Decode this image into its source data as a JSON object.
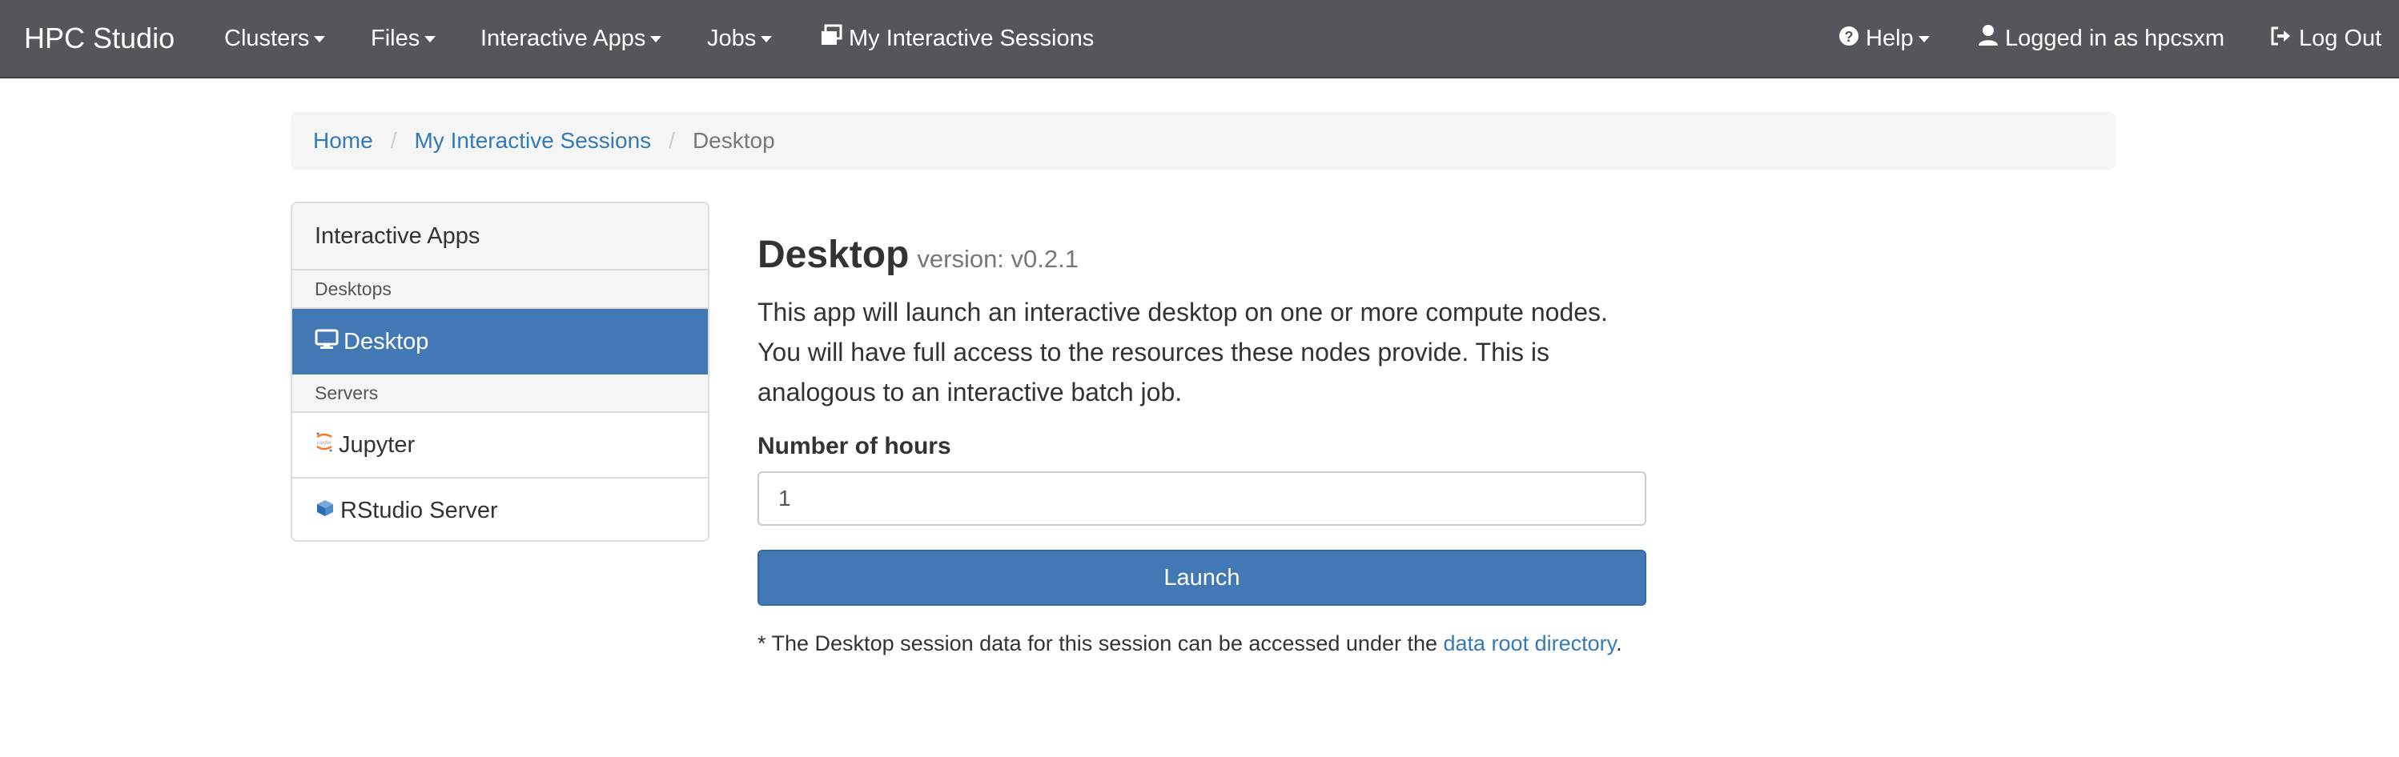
{
  "navbar": {
    "brand": "HPC Studio",
    "menus": [
      "Clusters",
      "Files",
      "Interactive Apps",
      "Jobs"
    ],
    "sessions_link": "My Interactive Sessions",
    "help": "Help",
    "user": "Logged in as hpcsxm",
    "logout": "Log Out",
    "bg_color": "#53565a"
  },
  "breadcrumb": {
    "home": "Home",
    "sessions": "My Interactive Sessions",
    "current": "Desktop"
  },
  "sidebar": {
    "heading": "Interactive Apps",
    "categories": [
      {
        "name": "Desktops",
        "items": [
          {
            "label": "Desktop",
            "icon": "monitor-icon",
            "active": true
          }
        ]
      },
      {
        "name": "Servers",
        "items": [
          {
            "label": "Jupyter",
            "icon": "jupyter-logo-icon"
          },
          {
            "label": "RStudio Server",
            "icon": "rstudio-cube-icon"
          }
        ]
      }
    ],
    "active_color": "#4279b5"
  },
  "app": {
    "title": "Desktop",
    "version": "version: v0.2.1",
    "description_lines": [
      "This app will launch an interactive desktop on one or more compute nodes.",
      "You will have full access to the resources these nodes provide. This is",
      "analogous to an interactive batch job."
    ],
    "hours_label": "Number of hours",
    "hours_value": "1",
    "launch_label": "Launch",
    "note_prefix": "* The Desktop session data for this session can be accessed under the ",
    "note_link": "data root directory",
    "note_suffix": "."
  }
}
